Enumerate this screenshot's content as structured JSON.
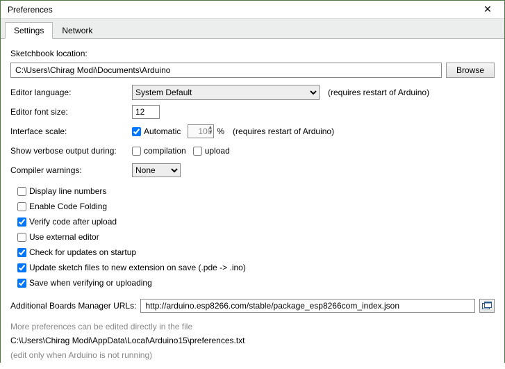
{
  "window": {
    "title": "Preferences",
    "close": "✕"
  },
  "tabs": {
    "settings": "Settings",
    "network": "Network"
  },
  "sketchbook": {
    "label": "Sketchbook location:",
    "value": "C:\\Users\\Chirag Modi\\Documents\\Arduino",
    "browse": "Browse"
  },
  "language": {
    "label": "Editor language:",
    "value": "System Default",
    "hint": "(requires restart of Arduino)"
  },
  "fontsize": {
    "label": "Editor font size:",
    "value": "12"
  },
  "scale": {
    "label": "Interface scale:",
    "auto_label": "Automatic",
    "value": "100",
    "pct": "%",
    "hint": "(requires restart of Arduino)"
  },
  "verbose": {
    "label": "Show verbose output during:",
    "compilation": "compilation",
    "upload": "upload"
  },
  "warnings": {
    "label": "Compiler warnings:",
    "value": "None"
  },
  "checks": {
    "line_numbers": "Display line numbers",
    "code_folding": "Enable Code Folding",
    "verify_upload": "Verify code after upload",
    "external_editor": "Use external editor",
    "check_updates": "Check for updates on startup",
    "update_ext": "Update sketch files to new extension on save (.pde -> .ino)",
    "save_verify": "Save when verifying or uploading"
  },
  "urls": {
    "label": "Additional Boards Manager URLs:",
    "value": "http://arduino.esp8266.com/stable/package_esp8266com_index.json"
  },
  "footer": {
    "line1": "More preferences can be edited directly in the file",
    "path": "C:\\Users\\Chirag Modi\\AppData\\Local\\Arduino15\\preferences.txt",
    "line3": "(edit only when Arduino is not running)"
  }
}
